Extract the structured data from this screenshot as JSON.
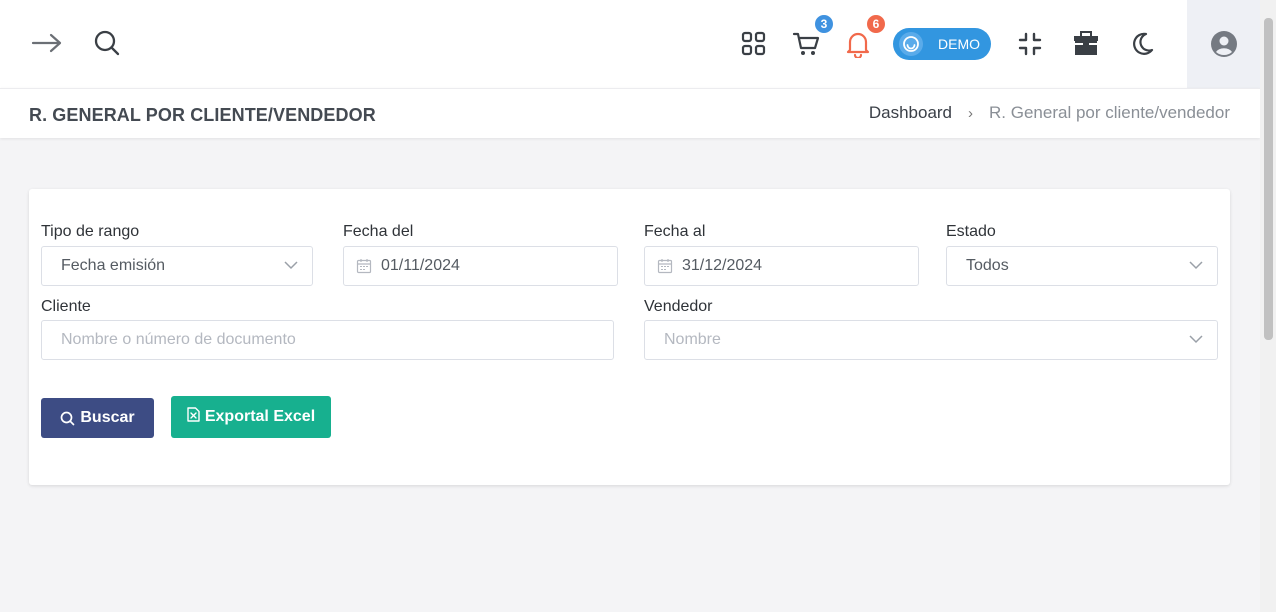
{
  "topbar": {
    "left_icons": [
      "arrow-right-icon",
      "search-icon"
    ],
    "right_icons": [
      "apps-grid-icon",
      "cart-icon",
      "bell-icon",
      "compress-icon",
      "store-icon",
      "moon-icon",
      "user-circle-icon"
    ],
    "cart_badge": "3",
    "bell_badge": "6",
    "demo_label": "DEMO",
    "colors": {
      "cart_badge": "#3f92e0",
      "bell_badge": "#f1694b",
      "demo_pill": "#3296e0",
      "bell_icon": "#f1694b"
    }
  },
  "header": {
    "title": "R. GENERAL POR CLIENTE/VENDEDOR",
    "breadcrumb": {
      "link": "Dashboard",
      "separator": "›",
      "current": "R. General por cliente/vendedor"
    }
  },
  "filters": {
    "tipo_rango": {
      "label": "Tipo de rango",
      "value": "Fecha emisión"
    },
    "fecha_del": {
      "label": "Fecha del",
      "value": "01/11/2024"
    },
    "fecha_al": {
      "label": "Fecha al",
      "value": "31/12/2024"
    },
    "estado": {
      "label": "Estado",
      "value": "Todos"
    },
    "cliente": {
      "label": "Cliente",
      "placeholder": "Nombre o número de documento"
    },
    "vendedor": {
      "label": "Vendedor",
      "placeholder": "Nombre"
    }
  },
  "actions": {
    "buscar": "Buscar",
    "exportar": "Exportal Excel",
    "colors": {
      "buscar": "#3d4c84",
      "exportar": "#17b08f"
    }
  }
}
